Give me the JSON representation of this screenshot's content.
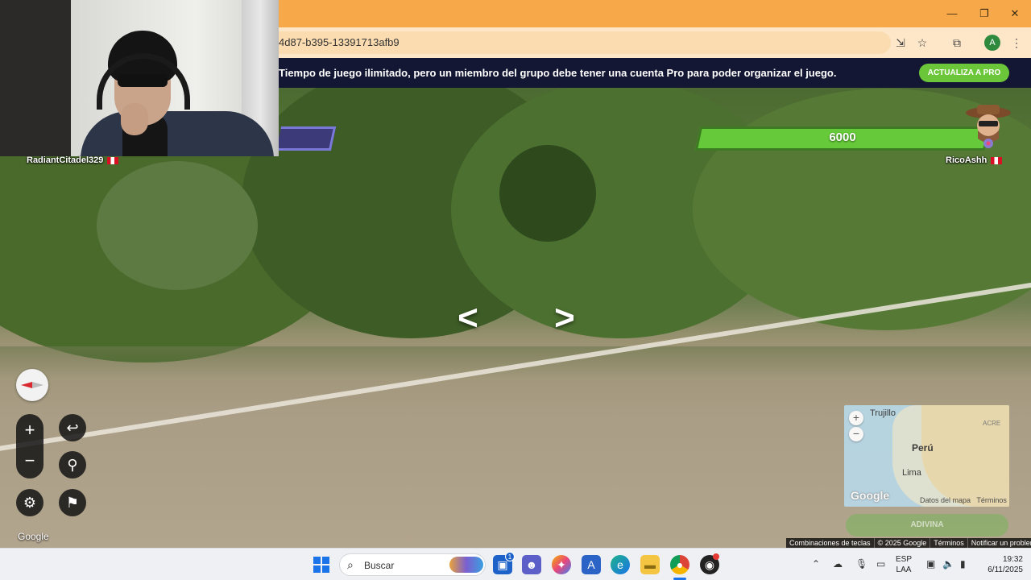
{
  "browser": {
    "url_fragment": "4d87-b395-13391713afb9",
    "minimize": "—",
    "restore": "❐",
    "close": "✕",
    "profile_initial": "A"
  },
  "promo": {
    "text": "Tiempo de juego ilimitado, pero un miembro del grupo debe tener una cuenta Pro para poder organizar el juego.",
    "button": "ACTUALIZA A PRO"
  },
  "players": {
    "left": {
      "name": "RadiantCitadel329"
    },
    "right": {
      "name": "RicoAshh",
      "health": "6000"
    }
  },
  "controls": {
    "zoom_in": "+",
    "zoom_out": "−",
    "undo": "↩",
    "checkpoint": "⚲",
    "settings": "⚙",
    "flag": "⚑",
    "google": "Google"
  },
  "minimap": {
    "labels": {
      "trujillo": "Trujillo",
      "peru": "Perú",
      "lima": "Lima",
      "acre": "ACRE"
    },
    "zoom_in": "+",
    "zoom_out": "−",
    "google": "Google",
    "map_data": "Datos del mapa",
    "terms": "Términos",
    "guess_button": "ADIVINA"
  },
  "attribution": {
    "shortcuts": "Combinaciones de teclas",
    "copyright": "© 2025 Google",
    "terms": "Términos",
    "report": "Notificar un problema"
  },
  "taskbar": {
    "search_placeholder": "Buscar",
    "store_badge": "1",
    "lang_top": "ESP",
    "lang_bottom": "LAA",
    "time": "19:32",
    "date": "6/11/2025"
  }
}
